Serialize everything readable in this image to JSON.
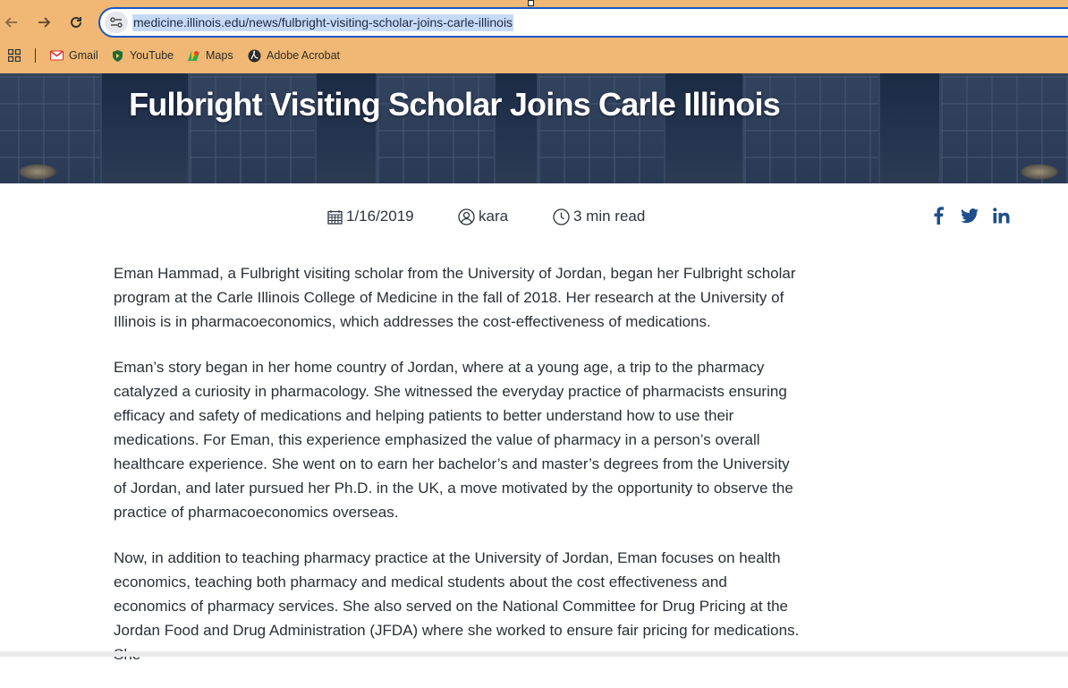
{
  "browser": {
    "url": "medicine.illinois.edu/news/fulbright-visiting-scholar-joins-carle-illinois",
    "nav_icons": [
      "back-arrow-icon",
      "forward-arrow-icon",
      "reload-icon"
    ],
    "bookmarks": [
      {
        "label": "Gmail",
        "icon": "gmail-icon"
      },
      {
        "label": "YouTube",
        "icon": "youtube-icon"
      },
      {
        "label": "Maps",
        "icon": "maps-icon"
      },
      {
        "label": "Adobe Acrobat",
        "icon": "acrobat-icon"
      }
    ],
    "accent_color": "#f0b874"
  },
  "hero": {
    "title": "Fulbright Visiting Scholar Joins Carle Illinois"
  },
  "meta": {
    "date": "1/16/2019",
    "author": "kara",
    "read_time": "3 min read"
  },
  "social": [
    "facebook-icon",
    "twitter-icon",
    "linkedin-icon"
  ],
  "article": {
    "paragraphs": [
      "Eman Hammad, a Fulbright visiting scholar from the University of Jordan, began her Fulbright scholar program at the Carle Illinois College of Medicine in the fall of 2018. Her research at the University of Illinois is in pharmacoeconomics, which addresses the cost-effectiveness of medications.",
      "Eman’s story began in her home country of Jordan, where at a young age, a trip to the pharmacy catalyzed a curiosity in pharmacology. She witnessed the everyday practice of pharmacists ensuring efficacy and safety of medications and helping patients to better understand how to use their medications. For Eman, this experience emphasized the value of pharmacy in a person’s overall healthcare experience. She went on to earn her bachelor’s and master’s degrees from the University of Jordan, and later pursued her Ph.D. in the UK, a move motivated by the opportunity to observe the practice of pharmacoeconomics overseas.",
      "Now, in addition to teaching pharmacy practice at the University of Jordan, Eman focuses on health economics, teaching both pharmacy and medical students about the cost effectiveness and economics of pharmacy services. She also served on the National Committee for Drug Pricing at the Jordan Food and Drug Administration (JFDA) where she worked to ensure fair pricing for medications. She"
    ]
  }
}
